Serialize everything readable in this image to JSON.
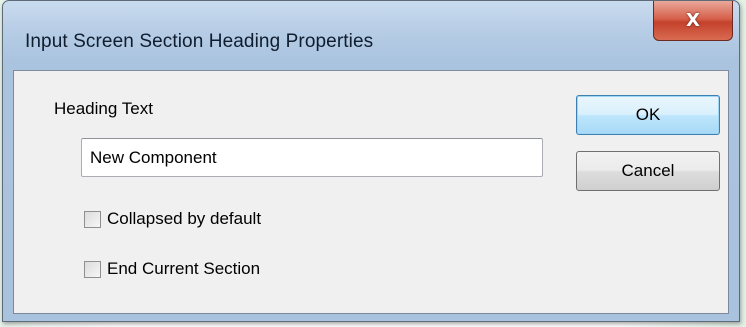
{
  "dialog": {
    "title": "Input Screen Section Heading Properties",
    "close_label": "X"
  },
  "form": {
    "heading_label": "Heading Text",
    "heading_value": "New Component",
    "collapsed_label": "Collapsed by default",
    "collapsed_checked": false,
    "end_section_label": "End Current Section",
    "end_section_checked": false
  },
  "buttons": {
    "ok_label": "OK",
    "cancel_label": "Cancel"
  }
}
